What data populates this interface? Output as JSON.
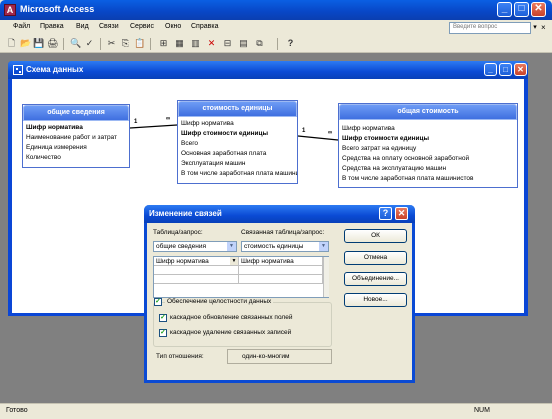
{
  "app": {
    "title": "Microsoft Access",
    "icon_letter": "A"
  },
  "window_buttons": {
    "minimize": "_",
    "maximize": "□",
    "close": "✕"
  },
  "menu": {
    "items": [
      "Файл",
      "Правка",
      "Вид",
      "Связи",
      "Сервис",
      "Окно",
      "Справка"
    ],
    "help_placeholder": "Введите вопрос",
    "close": "×"
  },
  "toolbar": {
    "icons": [
      "new-icon",
      "open-icon",
      "save-icon",
      "print-icon",
      "preview-icon",
      "spelling-icon",
      "cut-icon",
      "copy-icon",
      "paste-icon",
      "show-table-icon",
      "show-direct-icon",
      "show-all-icon",
      "delete-icon",
      "relationships-icon",
      "db-window-icon",
      "new-object-icon",
      "help-icon"
    ],
    "glyphs": [
      "🗋",
      "📂",
      "💾",
      "🖨",
      "🔍",
      "✓",
      "✂",
      "⎘",
      "📋",
      "⊞",
      "▦",
      "▥",
      "✕",
      "⊟",
      "▤",
      "⧉",
      "?"
    ]
  },
  "child_window": {
    "title": "Схема данных"
  },
  "tables": [
    {
      "title": "общие сведения",
      "fields": [
        {
          "name": "Шифр норматива",
          "key": true
        },
        {
          "name": "Наименование работ и затрат",
          "key": false
        },
        {
          "name": "Единица измерения",
          "key": false
        },
        {
          "name": "Количество",
          "key": false
        }
      ]
    },
    {
      "title": "стоимость единицы",
      "fields": [
        {
          "name": "Шифр норматива",
          "key": false
        },
        {
          "name": "Шифр стоимости единицы",
          "key": true
        },
        {
          "name": "Всего",
          "key": false
        },
        {
          "name": "Основная заработная плата",
          "key": false
        },
        {
          "name": "Эксплуатация машин",
          "key": false
        },
        {
          "name": "В том числе заработная плата машинистов",
          "key": false
        }
      ]
    },
    {
      "title": "общая стоимость",
      "fields": [
        {
          "name": "Шифр норматива",
          "key": false
        },
        {
          "name": "Шифр стоимости единицы",
          "key": true
        },
        {
          "name": "Всего затрат на единицу",
          "key": false
        },
        {
          "name": "Средства на оплату основной заработной",
          "key": false
        },
        {
          "name": "Средства на эксплуатацию машин",
          "key": false
        },
        {
          "name": "В том числе заработная плата машинистов",
          "key": false
        }
      ]
    }
  ],
  "relations": [
    {
      "from": "1",
      "to": "∞"
    },
    {
      "from": "1",
      "to": "∞"
    }
  ],
  "dialog": {
    "title": "Изменение связей",
    "help_btn": "?",
    "close_btn": "✕",
    "table_label": "Таблица/запрос:",
    "related_label": "Связанная таблица/запрос:",
    "table_value": "общие сведения",
    "related_value": "стоимость единицы",
    "grid": {
      "left_field": "Шифр норматива",
      "right_field": "Шифр норматива"
    },
    "buttons": {
      "ok": "ОК",
      "cancel": "Отмена",
      "join": "Объединение...",
      "new": "Новое..."
    },
    "checkboxes": {
      "integrity": {
        "label": "Обеспечение целостности данных",
        "checked": true
      },
      "cascade_update": {
        "label": "каскадное обновление связанных полей",
        "checked": true
      },
      "cascade_delete": {
        "label": "каскадное удаление связанных записей",
        "checked": true
      }
    },
    "relation_type_label": "Тип отношения:",
    "relation_type_value": "один-ко-многим"
  },
  "status": {
    "left": "Готово",
    "right": "NUM"
  }
}
